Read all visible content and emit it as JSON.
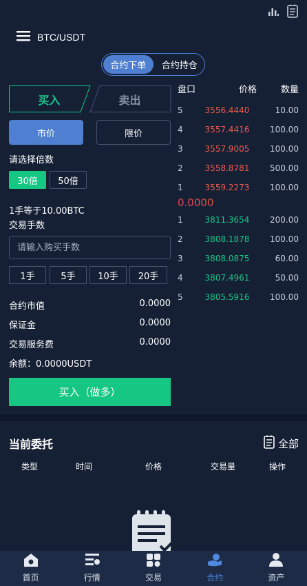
{
  "header": {
    "title": "BTC/USDT"
  },
  "switch": {
    "tab1": "合约下单",
    "tab2": "合约持仓"
  },
  "form": {
    "buy_tab": "买入",
    "sell_tab": "卖出",
    "market": "市价",
    "limit": "限价",
    "leverage_label": "请选择倍数",
    "lev1": "30倍",
    "lev2": "50倍",
    "lot_info": "1手等于10.00BTC",
    "qty_label": "交易手数",
    "qty_placeholder": "请输入购买手数",
    "hands": [
      "1手",
      "5手",
      "10手",
      "20手"
    ],
    "market_value_label": "合约市值",
    "market_value": "0.0000",
    "margin_label": "保证金",
    "margin": "0.0000",
    "fee_label": "交易服务费",
    "fee": "0.0000",
    "balance": "余额：0.0000USDT",
    "submit": "买入（做多）"
  },
  "orderbook": {
    "head": [
      "盘口",
      "价格",
      "数量"
    ],
    "asks": [
      {
        "lv": "5",
        "price": "3556.4440",
        "amount": "10.00"
      },
      {
        "lv": "4",
        "price": "3557.4416",
        "amount": "100.00"
      },
      {
        "lv": "3",
        "price": "3557.9005",
        "amount": "100.00"
      },
      {
        "lv": "2",
        "price": "3558.8781",
        "amount": "500.00"
      },
      {
        "lv": "1",
        "price": "3559.2273",
        "amount": "100.00"
      }
    ],
    "mid": "0.0000",
    "bids": [
      {
        "lv": "1",
        "price": "3811.3654",
        "amount": "200.00"
      },
      {
        "lv": "2",
        "price": "3808.1878",
        "amount": "100.00"
      },
      {
        "lv": "3",
        "price": "3808.0875",
        "amount": "60.00"
      },
      {
        "lv": "4",
        "price": "3807.4961",
        "amount": "50.00"
      },
      {
        "lv": "5",
        "price": "3805.5916",
        "amount": "100.00"
      }
    ]
  },
  "orders": {
    "title": "当前委托",
    "all": "全部",
    "cols": [
      "类型",
      "时间",
      "价格",
      "交易量",
      "操作"
    ]
  },
  "nav": [
    "首页",
    "行情",
    "交易",
    "合约",
    "资产"
  ],
  "colors": {
    "accent": "#4f7fd0",
    "buy": "#16c784",
    "sell": "#f0594e",
    "bg": "#152035"
  }
}
